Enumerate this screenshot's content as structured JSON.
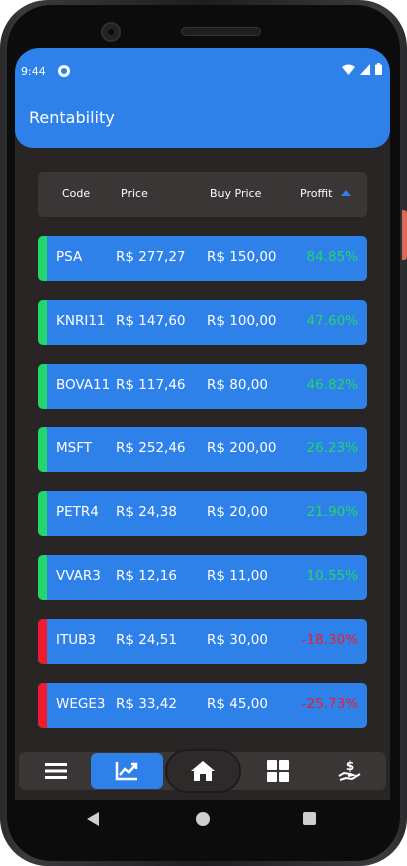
{
  "status": {
    "time": "9:44"
  },
  "appbar": {
    "title": "Rentability"
  },
  "table": {
    "headers": {
      "code": "Code",
      "price": "Price",
      "buy_price": "Buy Price",
      "profit": "Proffit"
    },
    "sort": {
      "column": "profit",
      "direction": "ascending"
    },
    "rows": [
      {
        "code": "PSA",
        "price": "R$ 277,27",
        "buy_price": "R$ 150,00",
        "profit": "84.85%",
        "trend": "up"
      },
      {
        "code": "KNRI11",
        "price": "R$ 147,60",
        "buy_price": "R$ 100,00",
        "profit": "47.60%",
        "trend": "up"
      },
      {
        "code": "BOVA11",
        "price": "R$ 117,46",
        "buy_price": "R$ 80,00",
        "profit": "46.82%",
        "trend": "up"
      },
      {
        "code": "MSFT",
        "price": "R$ 252,46",
        "buy_price": "R$ 200,00",
        "profit": "26.23%",
        "trend": "up"
      },
      {
        "code": "PETR4",
        "price": "R$ 24,38",
        "buy_price": "R$ 20,00",
        "profit": "21.90%",
        "trend": "up"
      },
      {
        "code": "VVAR3",
        "price": "R$ 12,16",
        "buy_price": "R$ 11,00",
        "profit": "10.55%",
        "trend": "up"
      },
      {
        "code": "ITUB3",
        "price": "R$ 24,51",
        "buy_price": "R$ 30,00",
        "profit": "-18.30%",
        "trend": "down"
      },
      {
        "code": "WEGE3",
        "price": "R$ 33,42",
        "buy_price": "R$ 45,00",
        "profit": "-25.73%",
        "trend": "down"
      }
    ]
  },
  "bottom_nav": {
    "items": [
      {
        "icon": "menu-icon"
      },
      {
        "icon": "chart-icon",
        "active": true
      },
      {
        "icon": "home-icon"
      },
      {
        "icon": "grid-icon"
      },
      {
        "icon": "money-hand-icon"
      }
    ]
  },
  "colors": {
    "primary": "#2f81ea",
    "background": "#292525",
    "header_bg": "#3a3636",
    "positive": "#21d66a",
    "negative": "#ee1c2e"
  }
}
